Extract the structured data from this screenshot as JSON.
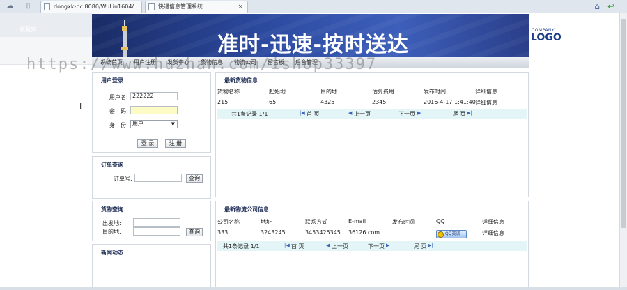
{
  "browser": {
    "tabs": [
      {
        "title": "dongxk-pc:8080/WuLiu1604/"
      },
      {
        "title": "快递信息管理系统"
      }
    ],
    "close_glyph": "×",
    "icons": [
      "cloud-icon",
      "page-icon",
      "home-icon",
      "back-arrow-icon"
    ]
  },
  "sidebar": {
    "label": "收藏夹"
  },
  "banner": {
    "slogan": "准时-迅速-按时送达",
    "logo_small": "COMPANY",
    "logo_big": "LOGO"
  },
  "menu": {
    "items": [
      "系统首页",
      "用户注册",
      "发货中心",
      "货物信息",
      "物流公司",
      "留言板",
      "后台管理"
    ]
  },
  "watermark": "https://www.huzhan.com/ishop33397",
  "login": {
    "title": "用户登录",
    "username_label": "用户名:",
    "username_value": "222222",
    "password_label": "密　码:",
    "password_value": "",
    "role_label": "身　份:",
    "role_value": "用户",
    "login_button": "登 录",
    "register_button": "注 册"
  },
  "order_query": {
    "title": "订单查询",
    "order_label": "订单号:",
    "query_button": "查询"
  },
  "goods_query": {
    "title": "货物查询",
    "from_label": "出发地:",
    "to_label": "目的地:",
    "query_button": "查询"
  },
  "news": {
    "title": "新闻动态"
  },
  "latest_goods": {
    "title": "最新货物信息",
    "headers": [
      "货物名称",
      "起始地",
      "目的地",
      "估算费用",
      "发布时间",
      "详细信息"
    ],
    "rows": [
      [
        "215",
        "65",
        "4325",
        "2345",
        "2016-4-17 1:41:40",
        "详细信息"
      ]
    ],
    "pager": {
      "total": "共1条记录 1/1",
      "first": "首 页",
      "prev": "上一页",
      "next": "下一页",
      "last": "尾 页"
    }
  },
  "latest_companies": {
    "title": "最新物流公司信息",
    "headers": [
      "公司名称",
      "地址",
      "联系方式",
      "E-mail",
      "发布时间",
      "QQ",
      "详细信息"
    ],
    "rows": [
      [
        "333",
        "3243245",
        "3453425345",
        "36126.com",
        "",
        "QQ交谈",
        "详细信息"
      ]
    ],
    "pager": {
      "total": "共1条记录 1/1",
      "first": "首 页",
      "prev": "上一页",
      "next": "下一页",
      "last": "尾 页"
    }
  }
}
